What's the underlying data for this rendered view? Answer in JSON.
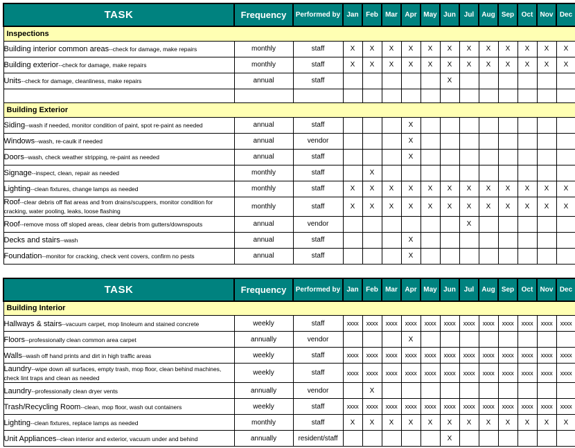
{
  "colors": {
    "header_teal": "#00827F",
    "section_yellow": "#FFFFB3",
    "grid_black": "#000000",
    "header_text": "#FFFFFF"
  },
  "columns": {
    "task": "TASK",
    "frequency": "Frequency",
    "performed_by": "Performed by",
    "months": [
      "Jan",
      "Feb",
      "Mar",
      "Apr",
      "May",
      "Jun",
      "Jul",
      "Aug",
      "Sep",
      "Oct",
      "Nov",
      "Dec"
    ]
  },
  "marks": {
    "single": "X",
    "weekly": "xxxx",
    "empty": ""
  },
  "blocks": [
    {
      "header": {
        "task": "TASK",
        "frequency": "Frequency",
        "performed_by": "Performed by",
        "months": [
          "Jan",
          "Feb",
          "Mar",
          "Apr",
          "May",
          "Jun",
          "Jul",
          "Aug",
          "Sep",
          "Oct",
          "Nov",
          "Dec"
        ]
      },
      "sections": [
        {
          "title": "Inspections",
          "rows": [
            {
              "name": "Building interior common areas",
              "desc": "--check for damage, make repairs",
              "frequency": "monthly",
              "performed_by": "staff",
              "months": [
                "X",
                "X",
                "X",
                "X",
                "X",
                "X",
                "X",
                "X",
                "X",
                "X",
                "X",
                "X"
              ]
            },
            {
              "name": "Building exterior",
              "desc": "--check for damage, make repairs",
              "frequency": "monthly",
              "performed_by": "staff",
              "months": [
                "X",
                "X",
                "X",
                "X",
                "X",
                "X",
                "X",
                "X",
                "X",
                "X",
                "X",
                "X"
              ]
            },
            {
              "name": "Units",
              "desc": "--check for damage, cleanliness, make repairs",
              "frequency": "annual",
              "performed_by": "staff",
              "months": [
                "",
                "",
                "",
                "",
                "",
                "X",
                "",
                "",
                "",
                "",
                "",
                ""
              ]
            },
            {
              "name": "",
              "desc": "",
              "frequency": "",
              "performed_by": "",
              "months": [
                "",
                "",
                "",
                "",
                "",
                "",
                "",
                "",
                "",
                "",
                "",
                ""
              ]
            }
          ]
        },
        {
          "title": "Building Exterior",
          "rows": [
            {
              "name": "Siding",
              "desc": "--wash if needed, monitor condition of paint, spot re-paint as needed",
              "frequency": "annual",
              "performed_by": "staff",
              "months": [
                "",
                "",
                "",
                "X",
                "",
                "",
                "",
                "",
                "",
                "",
                "",
                ""
              ]
            },
            {
              "name": "Windows",
              "desc": "--wash, re-caulk if needed",
              "frequency": "annual",
              "performed_by": "vendor",
              "months": [
                "",
                "",
                "",
                "X",
                "",
                "",
                "",
                "",
                "",
                "",
                "",
                ""
              ]
            },
            {
              "name": "Doors",
              "desc": "--wash, check weather stripping, re-paint as needed",
              "frequency": "annual",
              "performed_by": "staff",
              "months": [
                "",
                "",
                "",
                "X",
                "",
                "",
                "",
                "",
                "",
                "",
                "",
                ""
              ]
            },
            {
              "name": "Signage",
              "desc": "--inspect, clean, repair as needed",
              "frequency": "monthly",
              "performed_by": "staff",
              "months": [
                "",
                "X",
                "",
                "",
                "",
                "",
                "",
                "",
                "",
                "",
                "",
                ""
              ]
            },
            {
              "name": "Lighting",
              "desc": "--clean fixtures, change lamps as needed",
              "frequency": "monthly",
              "performed_by": "staff",
              "months": [
                "X",
                "X",
                "X",
                "X",
                "X",
                "X",
                "X",
                "X",
                "X",
                "X",
                "X",
                "X"
              ]
            },
            {
              "name": "Roof",
              "desc": "--clear debris off flat areas and from drains/scuppers, monitor condition for cracking, water pooling, leaks, loose flashing",
              "frequency": "monthly",
              "performed_by": "staff",
              "tall": true,
              "months": [
                "X",
                "X",
                "X",
                "X",
                "X",
                "X",
                "X",
                "X",
                "X",
                "X",
                "X",
                "X"
              ]
            },
            {
              "name": "Roof",
              "desc": "--remove moss off sloped areas, clear debris from gutters/downspouts",
              "frequency": "annual",
              "performed_by": "vendor",
              "months": [
                "",
                "",
                "",
                "",
                "",
                "",
                "X",
                "",
                "",
                "",
                "",
                ""
              ]
            },
            {
              "name": "Decks and stairs",
              "desc": "--wash",
              "frequency": "annual",
              "performed_by": "staff",
              "months": [
                "",
                "",
                "",
                "X",
                "",
                "",
                "",
                "",
                "",
                "",
                "",
                ""
              ]
            },
            {
              "name": "Foundation",
              "desc": "--monitor for cracking, check vent covers, confirm no pests",
              "frequency": "annual",
              "performed_by": "staff",
              "months": [
                "",
                "",
                "",
                "X",
                "",
                "",
                "",
                "",
                "",
                "",
                "",
                ""
              ]
            }
          ]
        }
      ]
    },
    {
      "header": {
        "task": "TASK",
        "frequency": "Frequency",
        "performed_by": "Performed by",
        "months": [
          "Jan",
          "Feb",
          "Mar",
          "Apr",
          "May",
          "Jun",
          "Jul",
          "Aug",
          "Sep",
          "Oct",
          "Nov",
          "Dec"
        ]
      },
      "sections": [
        {
          "title": "Building Interior",
          "rows": [
            {
              "name": "Hallways & stairs",
              "desc": "--vacuum carpet, mop linoleum and stained concrete",
              "frequency": "weekly",
              "performed_by": "staff",
              "months": [
                "xxxx",
                "xxxx",
                "xxxx",
                "xxxx",
                "xxxx",
                "xxxx",
                "xxxx",
                "xxxx",
                "xxxx",
                "xxxx",
                "xxxx",
                "xxxx"
              ]
            },
            {
              "name": "Floors",
              "desc": "--professionally clean common area carpet",
              "frequency": "annually",
              "performed_by": "vendor",
              "months": [
                "",
                "",
                "",
                "X",
                "",
                "",
                "",
                "",
                "",
                "",
                "",
                ""
              ]
            },
            {
              "name": "Walls",
              "desc": "--wash off hand prints and dirt in high traffic areas",
              "frequency": "weekly",
              "performed_by": "staff",
              "months": [
                "xxxx",
                "xxxx",
                "xxxx",
                "xxxx",
                "xxxx",
                "xxxx",
                "xxxx",
                "xxxx",
                "xxxx",
                "xxxx",
                "xxxx",
                "xxxx"
              ]
            },
            {
              "name": "Laundry",
              "desc": "--wipe down all surfaces, empty trash, mop floor, clean behind machines, check lint traps and clean as needed",
              "frequency": "weekly",
              "performed_by": "staff",
              "tall": true,
              "months": [
                "xxxx",
                "xxxx",
                "xxxx",
                "xxxx",
                "xxxx",
                "xxxx",
                "xxxx",
                "xxxx",
                "xxxx",
                "xxxx",
                "xxxx",
                "xxxx"
              ]
            },
            {
              "name": "Laundry",
              "desc": "--professionally clean dryer vents",
              "frequency": "annually",
              "performed_by": "vendor",
              "months": [
                "",
                "X",
                "",
                "",
                "",
                "",
                "",
                "",
                "",
                "",
                "",
                ""
              ]
            },
            {
              "name": "Trash/Recycling Room",
              "desc": "--clean, mop floor, wash out containers",
              "frequency": "weekly",
              "performed_by": "staff",
              "months": [
                "xxxx",
                "xxxx",
                "xxxx",
                "xxxx",
                "xxxx",
                "xxxx",
                "xxxx",
                "xxxx",
                "xxxx",
                "xxxx",
                "xxxx",
                "xxxx"
              ]
            },
            {
              "name": "Lighting",
              "desc": "--clean fixtures, replace lamps as needed",
              "frequency": "monthly",
              "performed_by": "staff",
              "months": [
                "X",
                "X",
                "X",
                "X",
                "X",
                "X",
                "X",
                "X",
                "X",
                "X",
                "X",
                "X"
              ]
            },
            {
              "name": "Unit Appliances",
              "desc": "--clean interior and exterior, vacuum under and behind",
              "frequency": "annually",
              "performed_by": "resident/staff",
              "months": [
                "",
                "",
                "",
                "",
                "",
                "X",
                "",
                "",
                "",
                "",
                "",
                ""
              ]
            }
          ]
        }
      ]
    }
  ]
}
